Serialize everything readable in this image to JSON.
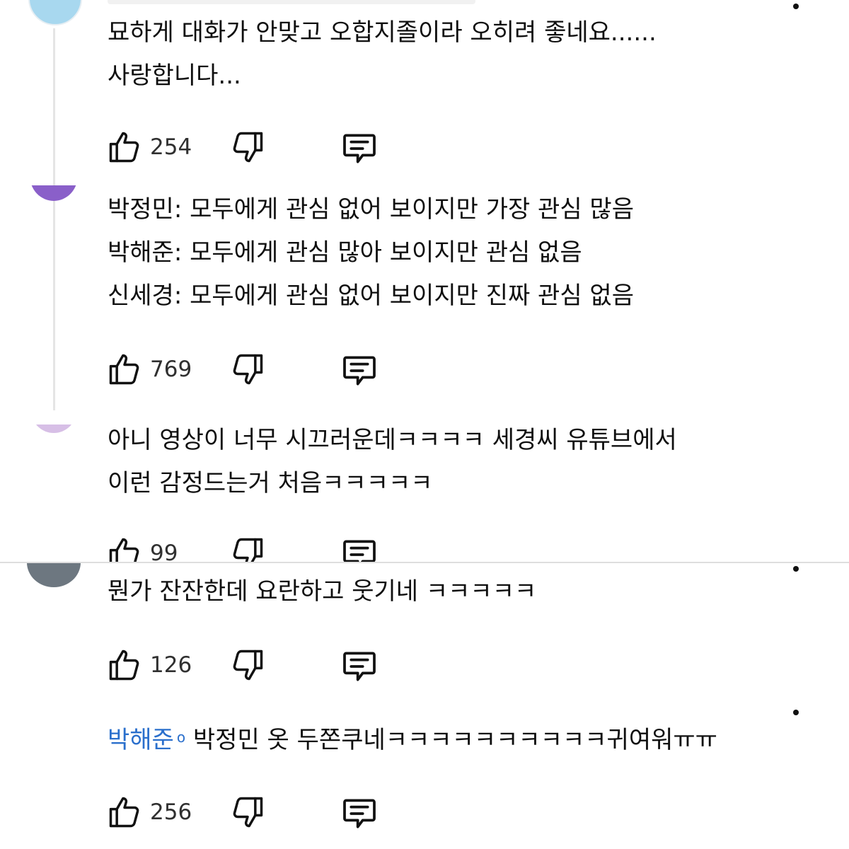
{
  "comments": [
    {
      "lines": [
        "묘하게 대화가 안맞고 오합지졸이라 오히려 좋네요......",
        "사랑합니다..."
      ],
      "likes": "254",
      "avatar_color": "#a8d8ef"
    },
    {
      "lines": [
        "박정민: 모두에게 관심 없어 보이지만 가장 관심 많음",
        "박해준: 모두에게 관심 많아 보이지만 관심 없음",
        "신세경: 모두에게 관심 없어 보이지만 진짜 관심 없음"
      ],
      "likes": "769",
      "avatar_color": "#8a5fc9"
    },
    {
      "lines": [
        "아니 영상이 너무 시끄러운데ㅋㅋㅋㅋ 세경씨 유튜브에서",
        "이런 감정드는거 처음ㅋㅋㅋㅋㅋ"
      ],
      "likes": "99",
      "avatar_color": "#d7bfe6"
    },
    {
      "lines": [
        "뭔가 잔잔한데 요란하고 웃기네 ㅋㅋㅋㅋㅋ"
      ],
      "likes": "126",
      "avatar_color": "#6d7780"
    },
    {
      "mention": "박해준",
      "mention_mark": "o",
      "lines": [
        "박정민 옷 두쫀쿠네ㅋㅋㅋㅋㅋㅋㅋㅋㅋㅋ귀여워ㅠㅠ"
      ],
      "likes": "256"
    }
  ]
}
